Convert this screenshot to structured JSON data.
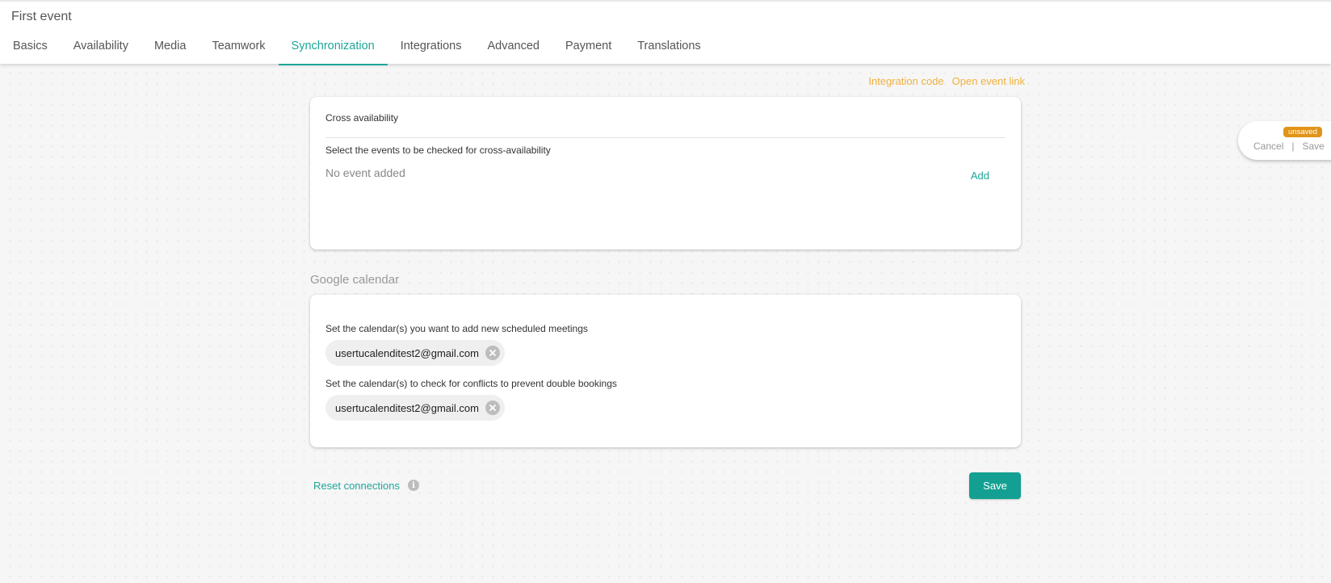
{
  "header": {
    "title": "First event",
    "tabs": [
      {
        "label": "Basics",
        "active": false
      },
      {
        "label": "Availability",
        "active": false
      },
      {
        "label": "Media",
        "active": false
      },
      {
        "label": "Teamwork",
        "active": false
      },
      {
        "label": "Synchronization",
        "active": true
      },
      {
        "label": "Integrations",
        "active": false
      },
      {
        "label": "Advanced",
        "active": false
      },
      {
        "label": "Payment",
        "active": false
      },
      {
        "label": "Translations",
        "active": false
      }
    ]
  },
  "top_links": {
    "integration_code": "Integration code",
    "open_event_link": "Open event link"
  },
  "cross_availability": {
    "title": "Cross availability",
    "label": "Select the events to be checked for cross-availability",
    "empty_text": "No event added",
    "add_label": "Add"
  },
  "google_calendar": {
    "heading": "Google calendar",
    "add_meetings_label": "Set the calendar(s) you want to add new scheduled meetings",
    "add_meetings_calendars": [
      "usertucalenditest2@gmail.com"
    ],
    "conflicts_label": "Set the calendar(s) to check for conflicts to prevent double bookings",
    "conflicts_calendars": [
      "usertucalenditest2@gmail.com"
    ]
  },
  "footer": {
    "reset_label": "Reset connections",
    "save_label": "Save"
  },
  "unsaved_panel": {
    "badge": "unsaved",
    "cancel_label": "Cancel",
    "separator": "|",
    "save_label": "Save"
  },
  "colors": {
    "accent": "#1ea699",
    "save_button": "#13a092",
    "link_orange": "#f0b13e",
    "badge_orange": "#e19418"
  }
}
